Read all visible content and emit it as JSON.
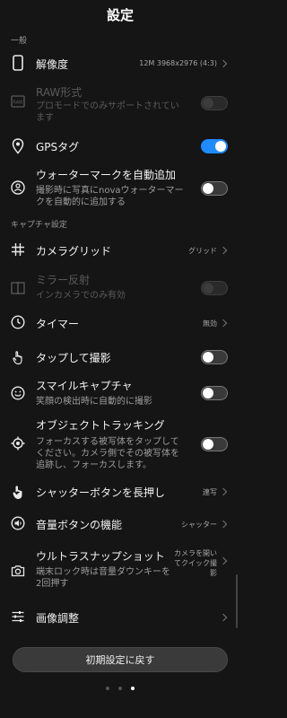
{
  "header": {
    "title": "設定"
  },
  "sections": {
    "general": "一般",
    "capture": "キャプチャ設定"
  },
  "rows": {
    "resolution": {
      "label": "解像度",
      "value": "12M 3968x2976 (4:3)"
    },
    "raw": {
      "label": "RAW形式",
      "desc": "プロモードでのみサポートされています"
    },
    "gps": {
      "label": "GPSタグ"
    },
    "watermark": {
      "label": "ウォーターマークを自動追加",
      "desc": "撮影時に写真にnovaウォーターマークを自動的に追加する"
    },
    "grid": {
      "label": "カメラグリッド",
      "value": "グリッド"
    },
    "mirror": {
      "label": "ミラー反射",
      "desc": "インカメラでのみ有効"
    },
    "timer": {
      "label": "タイマー",
      "value": "無効"
    },
    "tap_capture": {
      "label": "タップして撮影"
    },
    "smile": {
      "label": "スマイルキャプチャ",
      "desc": "笑顔の検出時に自動的に撮影"
    },
    "tracking": {
      "label": "オブジェクトトラッキング",
      "desc": "フォーカスする被写体をタップしてください。カメラ側でその被写体を追跡し、フォーカスします。"
    },
    "shutter_hold": {
      "label": "シャッターボタンを長押し",
      "value": "連写"
    },
    "volume": {
      "label": "音量ボタンの機能",
      "value": "シャッター"
    },
    "ultra_snap": {
      "label": "ウルトラスナップショット",
      "desc": "端末ロック時は音量ダウンキーを2回押す",
      "value": "カメラを開いてクイック撮影"
    },
    "image_adjust": {
      "label": "画像調整"
    }
  },
  "toggles": {
    "raw": false,
    "gps": true,
    "watermark": false,
    "mirror": false,
    "tap_capture": false,
    "smile": false,
    "tracking": false
  },
  "reset_button": {
    "label": "初期設定に戻す"
  },
  "page_indicator": {
    "count": 3,
    "active": 3
  },
  "colors": {
    "accent": "#1e8bff",
    "background": "#151515"
  }
}
